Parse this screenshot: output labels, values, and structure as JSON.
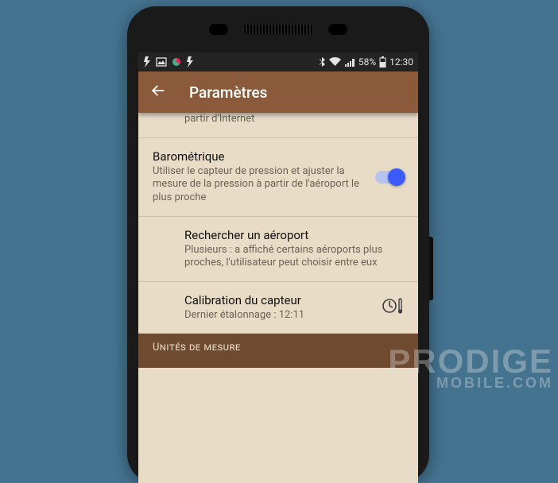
{
  "status": {
    "battery_text": "58%",
    "time": "12:30"
  },
  "appbar": {
    "title": "Paramètres"
  },
  "rows": {
    "internet_partial_sub": "partir d'Internet",
    "baro": {
      "title": "Barométrique",
      "sub": "Utiliser le capteur de pression et ajuster la mesure de la pression à partir de l'aéroport le plus proche",
      "enabled": true
    },
    "airport": {
      "title": "Rechercher un aéroport",
      "sub": "Plusieurs : a affiché certains aéroports plus proches, l'utilisateur peut choisir entre eux"
    },
    "calib": {
      "title": "Calibration du capteur",
      "sub": "Dernier étalonnage : 12:11"
    }
  },
  "section_header": "Unités de mesure",
  "watermark": {
    "line1": "PRODIGE",
    "line2": "MOBILE.COM"
  }
}
